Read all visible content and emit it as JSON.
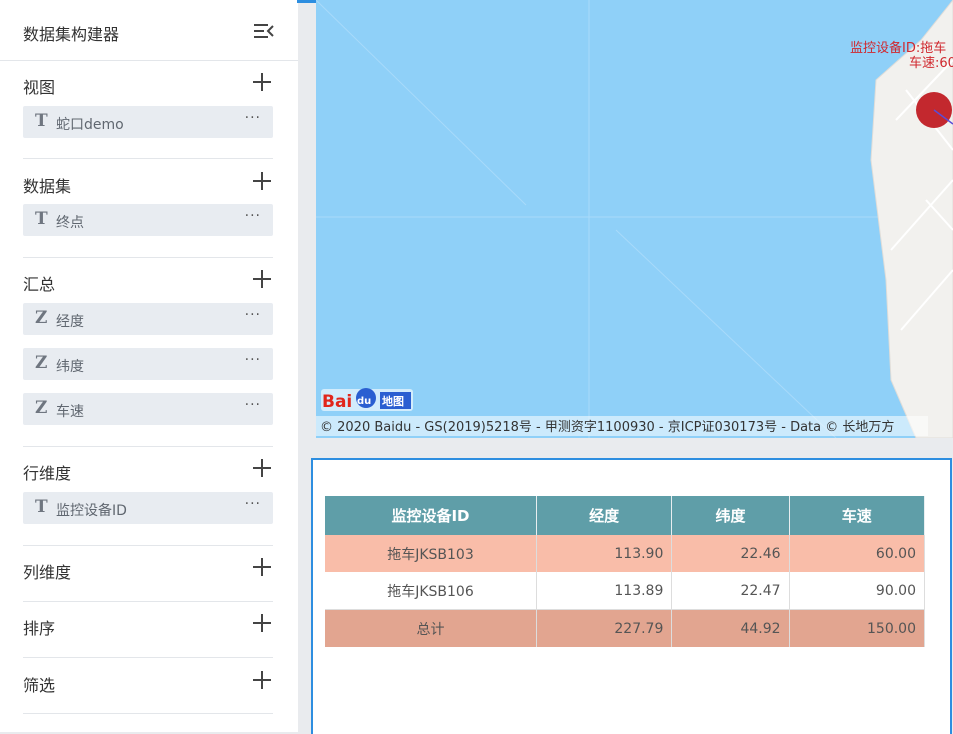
{
  "sidebar": {
    "title": "数据集构建器",
    "sections": {
      "view": {
        "title": "视图",
        "fields": [
          {
            "type": "T",
            "name": "蛇口demo",
            "more": "···"
          }
        ]
      },
      "dataset": {
        "title": "数据集",
        "fields": [
          {
            "type": "T",
            "name": "终点",
            "more": "···"
          }
        ]
      },
      "summary": {
        "title": "汇总",
        "fields": [
          {
            "type": "Z",
            "name": "经度",
            "more": "···"
          },
          {
            "type": "Z",
            "name": "纬度",
            "more": "···"
          },
          {
            "type": "Z",
            "name": "车速",
            "more": "···"
          }
        ]
      },
      "row_dim": {
        "title": "行维度",
        "fields": [
          {
            "type": "T",
            "name": "监控设备ID",
            "more": "···"
          }
        ]
      },
      "col_dim": {
        "title": "列维度"
      },
      "sort": {
        "title": "排序"
      },
      "filter": {
        "title": "筛选"
      }
    }
  },
  "map": {
    "marker_label_line1": "监控设备ID:拖车",
    "marker_label_line2": "车速:60",
    "logo_text": "Bai地图",
    "copyright": "© 2020 Baidu - GS(2019)5218号 - 甲测资字1100930 - 京ICP证030173号 - Data © 长地万方",
    "colors": {
      "water": "#8fd0f8",
      "land": "#f2f1ee",
      "marker": "#c3282e",
      "label": "#d0282e"
    }
  },
  "table": {
    "headers": [
      "监控设备ID",
      "经度",
      "纬度",
      "车速"
    ],
    "rows": [
      [
        "拖车JKSB103",
        "113.90",
        "22.46",
        "60.00"
      ],
      [
        "拖车JKSB106",
        "113.89",
        "22.47",
        "90.00"
      ]
    ],
    "total": [
      "总计",
      "227.79",
      "44.92",
      "150.00"
    ],
    "colors": {
      "header": "#5f9ea8",
      "row_highlight": "#f9bda9",
      "total": "#e2a590"
    }
  }
}
